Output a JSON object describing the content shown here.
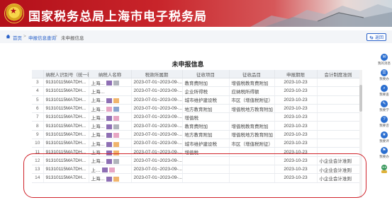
{
  "header": {
    "title": "国家税务总局上海市电子税务局",
    "colors": {
      "brand_red": "#b3101a",
      "link_blue": "#2a62c9",
      "highlight_red": "#d0232b"
    }
  },
  "breadcrumb": {
    "items": [
      "首页",
      "申报信息查询",
      "未申报信息"
    ],
    "separator": ">"
  },
  "back_button": {
    "label": "返回",
    "icon": "return-arrow-icon"
  },
  "page_title": "未申报信息",
  "table": {
    "columns": [
      "",
      "纳税人识别号（统一社会",
      "纳税人名称",
      "税款所属期",
      "征收项目",
      "征收品目",
      "申报期限",
      "会计制度准则"
    ],
    "rows": [
      {
        "no": "3",
        "tax_id": "91310115MA7DH...",
        "name": "上海…",
        "period": "2023-07-01~2023-09-...",
        "item": "教育费附加",
        "subitem": "增值税教育费附加",
        "deadline": "2023-10-23",
        "standard": ""
      },
      {
        "no": "4",
        "tax_id": "91310115MA7DH...",
        "name": "上海…",
        "period": "2023-07-01~2023-09-...",
        "item": "企业所得税",
        "subitem": "应纳税所得额",
        "deadline": "2023-10-23",
        "standard": ""
      },
      {
        "no": "5",
        "tax_id": "91310115MA7DH...",
        "name": "上海…",
        "period": "2023-07-01~2023-09-...",
        "item": "城市维护建设税",
        "subitem": "市区（增值税附征）",
        "deadline": "2023-10-23",
        "standard": ""
      },
      {
        "no": "6",
        "tax_id": "91310115MA7DH...",
        "name": "上海…",
        "period": "2023-07-01~2023-09-...",
        "item": "地方教育附加",
        "subitem": "增值税地方教育附加",
        "deadline": "2023-10-23",
        "standard": ""
      },
      {
        "no": "7",
        "tax_id": "91310115MA7DH...",
        "name": "上海…",
        "period": "2023-07-01~2023-09-...",
        "item": "增值税",
        "subitem": "",
        "deadline": "2023-10-23",
        "standard": ""
      },
      {
        "no": "8",
        "tax_id": "91310115MA7DH...",
        "name": "上海…",
        "period": "2023-07-01~2023-09-...",
        "item": "教育费附加",
        "subitem": "增值税教育费附加",
        "deadline": "2023-10-23",
        "standard": ""
      },
      {
        "no": "9",
        "tax_id": "91310115MA7DH...",
        "name": "上海…",
        "period": "2023-07-01~2023-09-...",
        "item": "地方教育附加",
        "subitem": "增值税地方教育附加",
        "deadline": "2023-10-23",
        "standard": ""
      },
      {
        "no": "10",
        "tax_id": "91310115MA7DH...",
        "name": "上海…",
        "period": "2023-07-01~2023-09-...",
        "item": "城市维护建设税",
        "subitem": "市区（增值税附征）",
        "deadline": "2023-10-23",
        "standard": ""
      },
      {
        "no": "11",
        "tax_id": "91310115MA7DH...",
        "name": "上海…",
        "period": "2023-07-01~2023-09-...",
        "item": "增值税",
        "subitem": "",
        "deadline": "2023-10-23",
        "standard": ""
      },
      {
        "no": "12",
        "tax_id": "91310115MA7DH...",
        "name": "上海…",
        "period": "2023-07-01~2023-09-...",
        "item": "",
        "subitem": "",
        "deadline": "2023-10-23",
        "standard": "小企业会计准则"
      },
      {
        "no": "13",
        "tax_id": "91310115MA7DH...",
        "name": "上…",
        "period": "2023-07-01~2023-09-...",
        "item": "",
        "subitem": "",
        "deadline": "2023-10-23",
        "standard": "小企业会计准则"
      },
      {
        "no": "14",
        "tax_id": "91310115MA7DH...",
        "name": "上海…",
        "period": "2023-07-01~2023-09-...",
        "item": "",
        "subitem": "",
        "deadline": "2023-10-23",
        "standard": "小企业会计准则"
      }
    ]
  },
  "right_sidebar": {
    "items": [
      {
        "label": "我的消息",
        "icon": "message-icon"
      },
      {
        "label": "我要办",
        "icon": "todo-icon"
      },
      {
        "label": "我要查",
        "icon": "search-icon"
      },
      {
        "label": "我要学",
        "icon": "learn-icon"
      },
      {
        "label": "我要咨",
        "icon": "consult-icon"
      },
      {
        "label": "我要评",
        "icon": "rate-icon"
      },
      {
        "label": "我要办",
        "icon": "handle-icon"
      },
      {
        "label": "",
        "icon": "assistant-icon"
      }
    ]
  }
}
